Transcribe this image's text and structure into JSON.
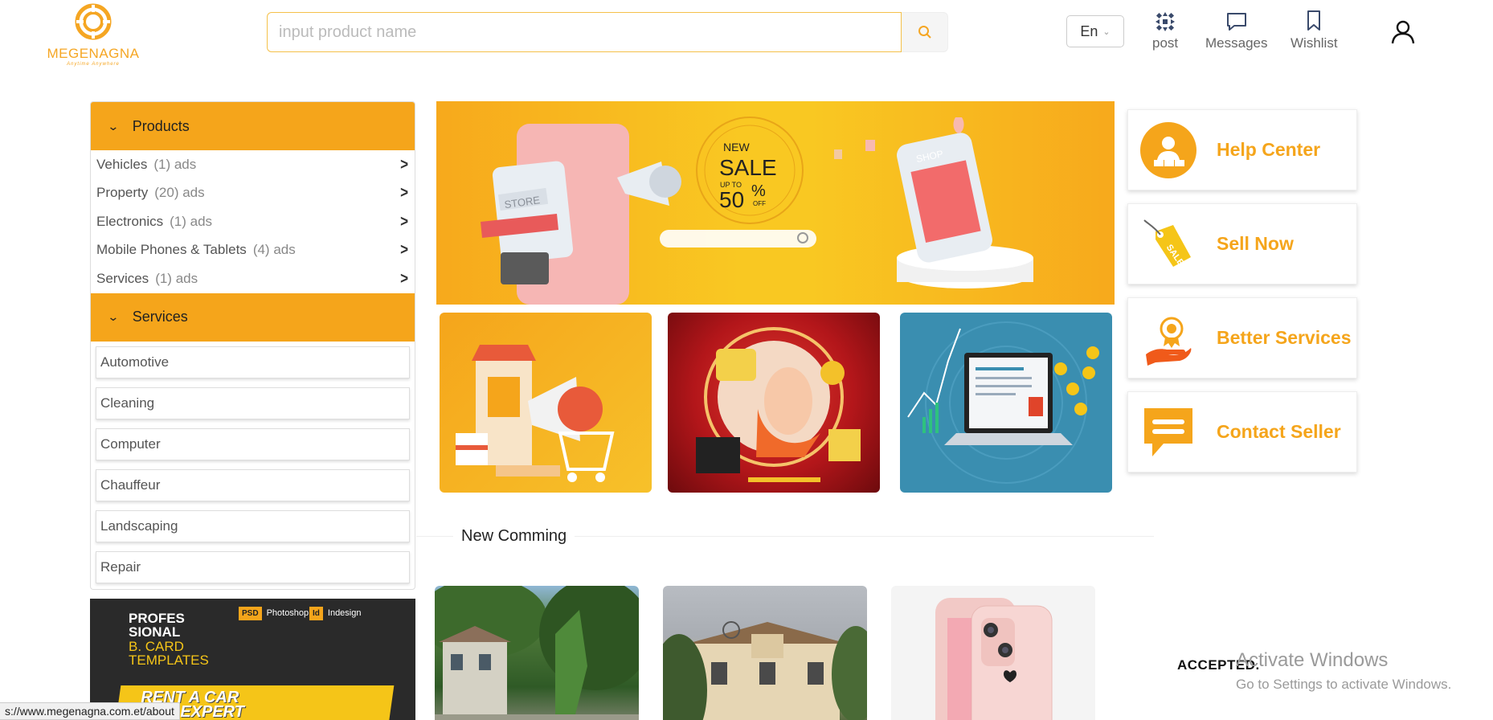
{
  "brand": {
    "name": "MEGENAGNA",
    "tagline": "Anytime Anywhere",
    "color": "#f5a623"
  },
  "search": {
    "placeholder": "input product name"
  },
  "language": {
    "selected": "En"
  },
  "nav": {
    "post": "post",
    "messages": "Messages",
    "wishlist": "Wishlist"
  },
  "products": {
    "header": "Products",
    "items": [
      {
        "label": "Vehicles",
        "count": "(1) ads"
      },
      {
        "label": "Property",
        "count": "(20) ads"
      },
      {
        "label": "Electronics",
        "count": "(1) ads"
      },
      {
        "label": "Mobile Phones & Tablets",
        "count": "(4) ads"
      },
      {
        "label": "Services",
        "count": "(1) ads"
      }
    ]
  },
  "services": {
    "header": "Services",
    "items": [
      "Automotive",
      "Cleaning",
      "Computer",
      "Chauffeur",
      "Landscaping",
      "Repair"
    ]
  },
  "side_ad": {
    "title": "PROFES SIONAL",
    "subtitle": "B. CARD TEMPLATES",
    "badge1_code": "PSD",
    "badge1": "Photoshop",
    "badge2_code": "Id",
    "badge2": "Indesign",
    "strip": "RENT A CAR PRO EXPERT"
  },
  "banner": {
    "new": "NEW",
    "sale": "SALE",
    "upto": "UP TO",
    "percent": "50",
    "off": "OFF",
    "store": "STORE",
    "shop": "SHOP"
  },
  "right_cards": [
    "Help Center",
    "Sell Now",
    "Better Services",
    "Contact Seller"
  ],
  "new_comming": {
    "title": "New Comming"
  },
  "status_url": "s://www.megenagna.com.et/about",
  "watermark": {
    "line1": "Activate Windows",
    "line2": "Go to Settings to activate Windows."
  },
  "accepted": "ACCEPTED.",
  "accent": "#f5a51b"
}
